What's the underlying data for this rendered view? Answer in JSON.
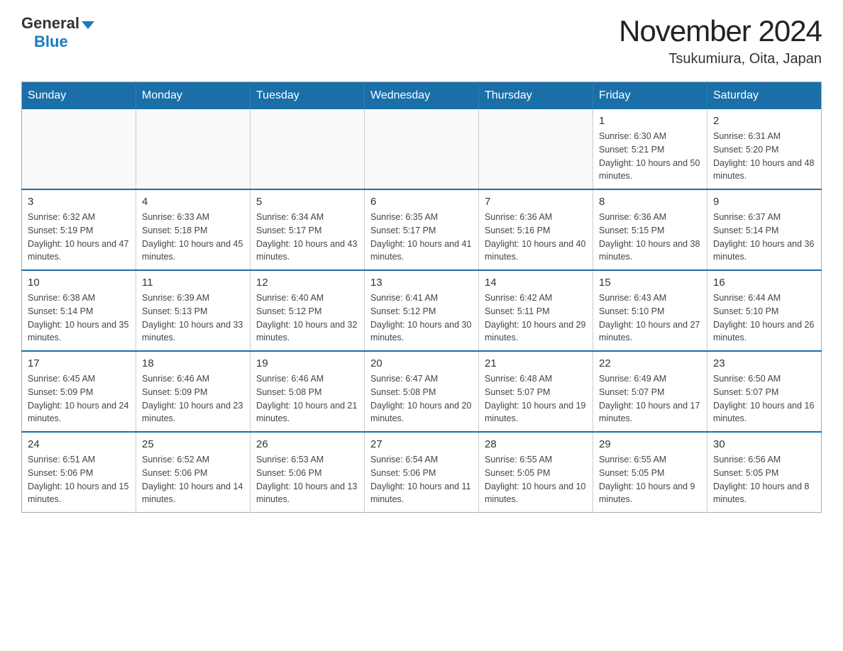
{
  "logo": {
    "general_text": "General",
    "blue_text": "Blue"
  },
  "title": "November 2024",
  "subtitle": "Tsukumiura, Oita, Japan",
  "weekdays": [
    "Sunday",
    "Monday",
    "Tuesday",
    "Wednesday",
    "Thursday",
    "Friday",
    "Saturday"
  ],
  "weeks": [
    [
      {
        "day": "",
        "info": ""
      },
      {
        "day": "",
        "info": ""
      },
      {
        "day": "",
        "info": ""
      },
      {
        "day": "",
        "info": ""
      },
      {
        "day": "",
        "info": ""
      },
      {
        "day": "1",
        "info": "Sunrise: 6:30 AM\nSunset: 5:21 PM\nDaylight: 10 hours and 50 minutes."
      },
      {
        "day": "2",
        "info": "Sunrise: 6:31 AM\nSunset: 5:20 PM\nDaylight: 10 hours and 48 minutes."
      }
    ],
    [
      {
        "day": "3",
        "info": "Sunrise: 6:32 AM\nSunset: 5:19 PM\nDaylight: 10 hours and 47 minutes."
      },
      {
        "day": "4",
        "info": "Sunrise: 6:33 AM\nSunset: 5:18 PM\nDaylight: 10 hours and 45 minutes."
      },
      {
        "day": "5",
        "info": "Sunrise: 6:34 AM\nSunset: 5:17 PM\nDaylight: 10 hours and 43 minutes."
      },
      {
        "day": "6",
        "info": "Sunrise: 6:35 AM\nSunset: 5:17 PM\nDaylight: 10 hours and 41 minutes."
      },
      {
        "day": "7",
        "info": "Sunrise: 6:36 AM\nSunset: 5:16 PM\nDaylight: 10 hours and 40 minutes."
      },
      {
        "day": "8",
        "info": "Sunrise: 6:36 AM\nSunset: 5:15 PM\nDaylight: 10 hours and 38 minutes."
      },
      {
        "day": "9",
        "info": "Sunrise: 6:37 AM\nSunset: 5:14 PM\nDaylight: 10 hours and 36 minutes."
      }
    ],
    [
      {
        "day": "10",
        "info": "Sunrise: 6:38 AM\nSunset: 5:14 PM\nDaylight: 10 hours and 35 minutes."
      },
      {
        "day": "11",
        "info": "Sunrise: 6:39 AM\nSunset: 5:13 PM\nDaylight: 10 hours and 33 minutes."
      },
      {
        "day": "12",
        "info": "Sunrise: 6:40 AM\nSunset: 5:12 PM\nDaylight: 10 hours and 32 minutes."
      },
      {
        "day": "13",
        "info": "Sunrise: 6:41 AM\nSunset: 5:12 PM\nDaylight: 10 hours and 30 minutes."
      },
      {
        "day": "14",
        "info": "Sunrise: 6:42 AM\nSunset: 5:11 PM\nDaylight: 10 hours and 29 minutes."
      },
      {
        "day": "15",
        "info": "Sunrise: 6:43 AM\nSunset: 5:10 PM\nDaylight: 10 hours and 27 minutes."
      },
      {
        "day": "16",
        "info": "Sunrise: 6:44 AM\nSunset: 5:10 PM\nDaylight: 10 hours and 26 minutes."
      }
    ],
    [
      {
        "day": "17",
        "info": "Sunrise: 6:45 AM\nSunset: 5:09 PM\nDaylight: 10 hours and 24 minutes."
      },
      {
        "day": "18",
        "info": "Sunrise: 6:46 AM\nSunset: 5:09 PM\nDaylight: 10 hours and 23 minutes."
      },
      {
        "day": "19",
        "info": "Sunrise: 6:46 AM\nSunset: 5:08 PM\nDaylight: 10 hours and 21 minutes."
      },
      {
        "day": "20",
        "info": "Sunrise: 6:47 AM\nSunset: 5:08 PM\nDaylight: 10 hours and 20 minutes."
      },
      {
        "day": "21",
        "info": "Sunrise: 6:48 AM\nSunset: 5:07 PM\nDaylight: 10 hours and 19 minutes."
      },
      {
        "day": "22",
        "info": "Sunrise: 6:49 AM\nSunset: 5:07 PM\nDaylight: 10 hours and 17 minutes."
      },
      {
        "day": "23",
        "info": "Sunrise: 6:50 AM\nSunset: 5:07 PM\nDaylight: 10 hours and 16 minutes."
      }
    ],
    [
      {
        "day": "24",
        "info": "Sunrise: 6:51 AM\nSunset: 5:06 PM\nDaylight: 10 hours and 15 minutes."
      },
      {
        "day": "25",
        "info": "Sunrise: 6:52 AM\nSunset: 5:06 PM\nDaylight: 10 hours and 14 minutes."
      },
      {
        "day": "26",
        "info": "Sunrise: 6:53 AM\nSunset: 5:06 PM\nDaylight: 10 hours and 13 minutes."
      },
      {
        "day": "27",
        "info": "Sunrise: 6:54 AM\nSunset: 5:06 PM\nDaylight: 10 hours and 11 minutes."
      },
      {
        "day": "28",
        "info": "Sunrise: 6:55 AM\nSunset: 5:05 PM\nDaylight: 10 hours and 10 minutes."
      },
      {
        "day": "29",
        "info": "Sunrise: 6:55 AM\nSunset: 5:05 PM\nDaylight: 10 hours and 9 minutes."
      },
      {
        "day": "30",
        "info": "Sunrise: 6:56 AM\nSunset: 5:05 PM\nDaylight: 10 hours and 8 minutes."
      }
    ]
  ]
}
